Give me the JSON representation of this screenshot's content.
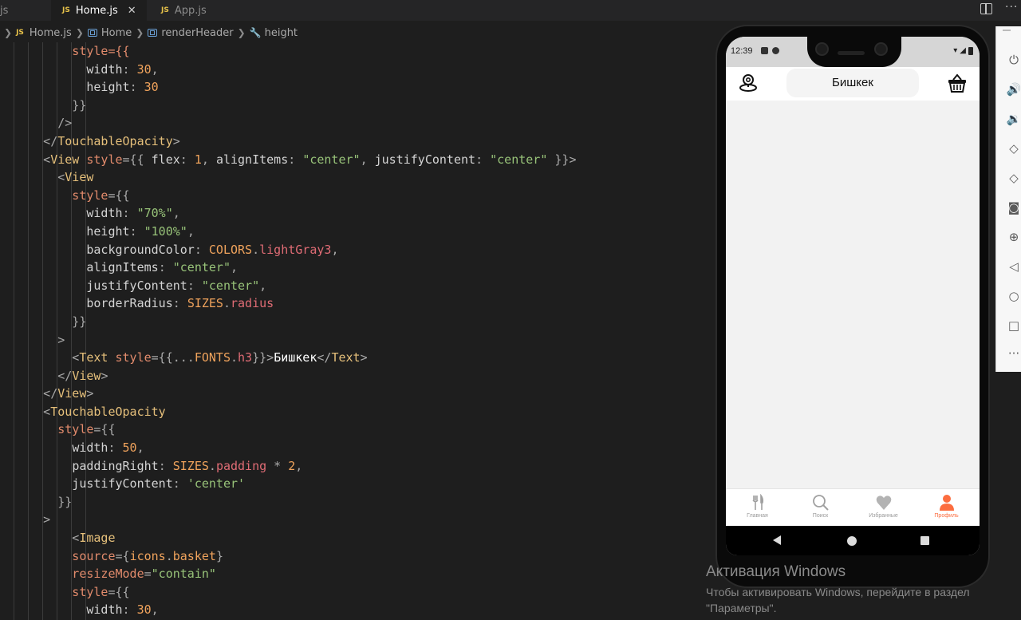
{
  "editor": {
    "tabs": [
      {
        "label": "js",
        "badge": "",
        "active": false
      },
      {
        "label": "Home.js",
        "badge": "JS",
        "active": true,
        "close_glyph": "✕"
      },
      {
        "label": "App.js",
        "badge": "JS",
        "active": false
      }
    ],
    "breadcrumb": [
      {
        "label": "Home.js",
        "badge": "JS",
        "icon": "js-file-icon"
      },
      {
        "label": "Home",
        "icon": "symbol-variable-icon"
      },
      {
        "label": "renderHeader",
        "icon": "symbol-variable-icon"
      },
      {
        "label": "height",
        "icon": "wrench-icon"
      }
    ],
    "code_lines": [
      [
        {
          "t": "          style={{",
          "c": "attr"
        }
      ],
      [
        {
          "t": "            ",
          "c": "plain"
        },
        {
          "t": "width",
          "c": "prop"
        },
        {
          "t": ": ",
          "c": "punc"
        },
        {
          "t": "30",
          "c": "num"
        },
        {
          "t": ",",
          "c": "punc"
        }
      ],
      [
        {
          "t": "            ",
          "c": "plain"
        },
        {
          "t": "height",
          "c": "prop"
        },
        {
          "t": ": ",
          "c": "punc"
        },
        {
          "t": "30",
          "c": "num"
        }
      ],
      [
        {
          "t": "          }}",
          "c": "punc"
        }
      ],
      [
        {
          "t": "        />",
          "c": "punc"
        }
      ],
      [
        {
          "t": "      </",
          "c": "punc"
        },
        {
          "t": "TouchableOpacity",
          "c": "tag"
        },
        {
          "t": ">",
          "c": "punc"
        }
      ],
      [
        {
          "t": "      <",
          "c": "punc"
        },
        {
          "t": "View",
          "c": "tag"
        },
        {
          "t": " style",
          "c": "attr"
        },
        {
          "t": "={{ ",
          "c": "punc"
        },
        {
          "t": "flex",
          "c": "prop"
        },
        {
          "t": ": ",
          "c": "punc"
        },
        {
          "t": "1",
          "c": "num"
        },
        {
          "t": ", ",
          "c": "punc"
        },
        {
          "t": "alignItems",
          "c": "prop"
        },
        {
          "t": ": ",
          "c": "punc"
        },
        {
          "t": "\"center\"",
          "c": "str"
        },
        {
          "t": ", ",
          "c": "punc"
        },
        {
          "t": "justifyContent",
          "c": "prop"
        },
        {
          "t": ": ",
          "c": "punc"
        },
        {
          "t": "\"center\"",
          "c": "str"
        },
        {
          "t": " }}>",
          "c": "punc"
        }
      ],
      [
        {
          "t": "        <",
          "c": "punc"
        },
        {
          "t": "View",
          "c": "tag"
        }
      ],
      [
        {
          "t": "          style",
          "c": "attr"
        },
        {
          "t": "={{",
          "c": "punc"
        }
      ],
      [
        {
          "t": "            ",
          "c": "plain"
        },
        {
          "t": "width",
          "c": "prop"
        },
        {
          "t": ": ",
          "c": "punc"
        },
        {
          "t": "\"70%\"",
          "c": "str"
        },
        {
          "t": ",",
          "c": "punc"
        }
      ],
      [
        {
          "t": "            ",
          "c": "plain"
        },
        {
          "t": "height",
          "c": "prop"
        },
        {
          "t": ": ",
          "c": "punc"
        },
        {
          "t": "\"100%\"",
          "c": "str"
        },
        {
          "t": ",",
          "c": "punc"
        }
      ],
      [
        {
          "t": "            ",
          "c": "plain"
        },
        {
          "t": "backgroundColor",
          "c": "prop"
        },
        {
          "t": ": ",
          "c": "punc"
        },
        {
          "t": "COLORS",
          "c": "num"
        },
        {
          "t": ".",
          "c": "punc"
        },
        {
          "t": "lightGray3",
          "c": "id"
        },
        {
          "t": ",",
          "c": "punc"
        }
      ],
      [
        {
          "t": "            ",
          "c": "plain"
        },
        {
          "t": "alignItems",
          "c": "prop"
        },
        {
          "t": ": ",
          "c": "punc"
        },
        {
          "t": "\"center\"",
          "c": "str"
        },
        {
          "t": ",",
          "c": "punc"
        }
      ],
      [
        {
          "t": "            ",
          "c": "plain"
        },
        {
          "t": "justifyContent",
          "c": "prop"
        },
        {
          "t": ": ",
          "c": "punc"
        },
        {
          "t": "\"center\"",
          "c": "str"
        },
        {
          "t": ",",
          "c": "punc"
        }
      ],
      [
        {
          "t": "            ",
          "c": "plain"
        },
        {
          "t": "borderRadius",
          "c": "prop"
        },
        {
          "t": ": ",
          "c": "punc"
        },
        {
          "t": "SIZES",
          "c": "num"
        },
        {
          "t": ".",
          "c": "punc"
        },
        {
          "t": "radius",
          "c": "id"
        }
      ],
      [
        {
          "t": "          }}",
          "c": "punc"
        }
      ],
      [
        {
          "t": "        >",
          "c": "punc"
        }
      ],
      [
        {
          "t": "          <",
          "c": "punc"
        },
        {
          "t": "Text",
          "c": "tag"
        },
        {
          "t": " style",
          "c": "attr"
        },
        {
          "t": "={{...",
          "c": "punc"
        },
        {
          "t": "FONTS",
          "c": "num"
        },
        {
          "t": ".",
          "c": "punc"
        },
        {
          "t": "h3",
          "c": "id"
        },
        {
          "t": "}}>",
          "c": "punc"
        },
        {
          "t": "Бишкек",
          "c": "txt"
        },
        {
          "t": "</",
          "c": "punc"
        },
        {
          "t": "Text",
          "c": "tag"
        },
        {
          "t": ">",
          "c": "punc"
        }
      ],
      [
        {
          "t": "        </",
          "c": "punc"
        },
        {
          "t": "View",
          "c": "tag"
        },
        {
          "t": ">",
          "c": "punc"
        }
      ],
      [
        {
          "t": "      </",
          "c": "punc"
        },
        {
          "t": "View",
          "c": "tag"
        },
        {
          "t": ">",
          "c": "punc"
        }
      ],
      [
        {
          "t": "      <",
          "c": "punc"
        },
        {
          "t": "TouchableOpacity",
          "c": "tag"
        }
      ],
      [
        {
          "t": "        style",
          "c": "attr"
        },
        {
          "t": "={{",
          "c": "punc"
        }
      ],
      [
        {
          "t": "          ",
          "c": "plain"
        },
        {
          "t": "width",
          "c": "prop"
        },
        {
          "t": ": ",
          "c": "punc"
        },
        {
          "t": "50",
          "c": "num"
        },
        {
          "t": ",",
          "c": "punc"
        }
      ],
      [
        {
          "t": "          ",
          "c": "plain"
        },
        {
          "t": "paddingRight",
          "c": "prop"
        },
        {
          "t": ": ",
          "c": "punc"
        },
        {
          "t": "SIZES",
          "c": "num"
        },
        {
          "t": ".",
          "c": "punc"
        },
        {
          "t": "padding",
          "c": "id"
        },
        {
          "t": " * ",
          "c": "punc"
        },
        {
          "t": "2",
          "c": "num"
        },
        {
          "t": ",",
          "c": "punc"
        }
      ],
      [
        {
          "t": "          ",
          "c": "plain"
        },
        {
          "t": "justifyContent",
          "c": "prop"
        },
        {
          "t": ": ",
          "c": "punc"
        },
        {
          "t": "'center'",
          "c": "str"
        }
      ],
      [
        {
          "t": "        }}",
          "c": "punc"
        }
      ],
      [
        {
          "t": "      >",
          "c": "punc"
        }
      ],
      [
        {
          "t": "          <",
          "c": "punc"
        },
        {
          "t": "Image",
          "c": "tag"
        }
      ],
      [
        {
          "t": "          source",
          "c": "attr"
        },
        {
          "t": "={",
          "c": "punc"
        },
        {
          "t": "icons",
          "c": "num"
        },
        {
          "t": ".",
          "c": "punc"
        },
        {
          "t": "basket",
          "c": "num"
        },
        {
          "t": "}",
          "c": "punc"
        }
      ],
      [
        {
          "t": "          resizeMode",
          "c": "attr"
        },
        {
          "t": "=",
          "c": "punc"
        },
        {
          "t": "\"contain\"",
          "c": "str"
        }
      ],
      [
        {
          "t": "          style",
          "c": "attr"
        },
        {
          "t": "={{",
          "c": "punc"
        }
      ],
      [
        {
          "t": "            ",
          "c": "plain"
        },
        {
          "t": "width",
          "c": "prop"
        },
        {
          "t": ": ",
          "c": "punc"
        },
        {
          "t": "30",
          "c": "num"
        },
        {
          "t": ",",
          "c": "punc"
        }
      ]
    ]
  },
  "phone": {
    "status_time": "12:39",
    "header_city": "Бишкек",
    "tabs": [
      {
        "label": "Главная",
        "icon": "cutlery-icon",
        "active": false
      },
      {
        "label": "Поиск",
        "icon": "search-icon",
        "active": false
      },
      {
        "label": "Избранные",
        "icon": "heart-icon",
        "active": false
      },
      {
        "label": "Профиль",
        "icon": "user-icon",
        "active": true
      }
    ],
    "accent_color": "#fc6d3f"
  },
  "emulator_controls": [
    "power-icon",
    "volume-up-icon",
    "volume-down-icon",
    "rotate-left-icon",
    "rotate-right-icon",
    "camera-icon",
    "zoom-icon",
    "back-icon",
    "home-icon",
    "overview-icon",
    "more-icon"
  ],
  "watermark": {
    "title": "Активация Windows",
    "line1": "Чтобы активировать Windows, перейдите в раздел",
    "line2": "\"Параметры\"."
  }
}
